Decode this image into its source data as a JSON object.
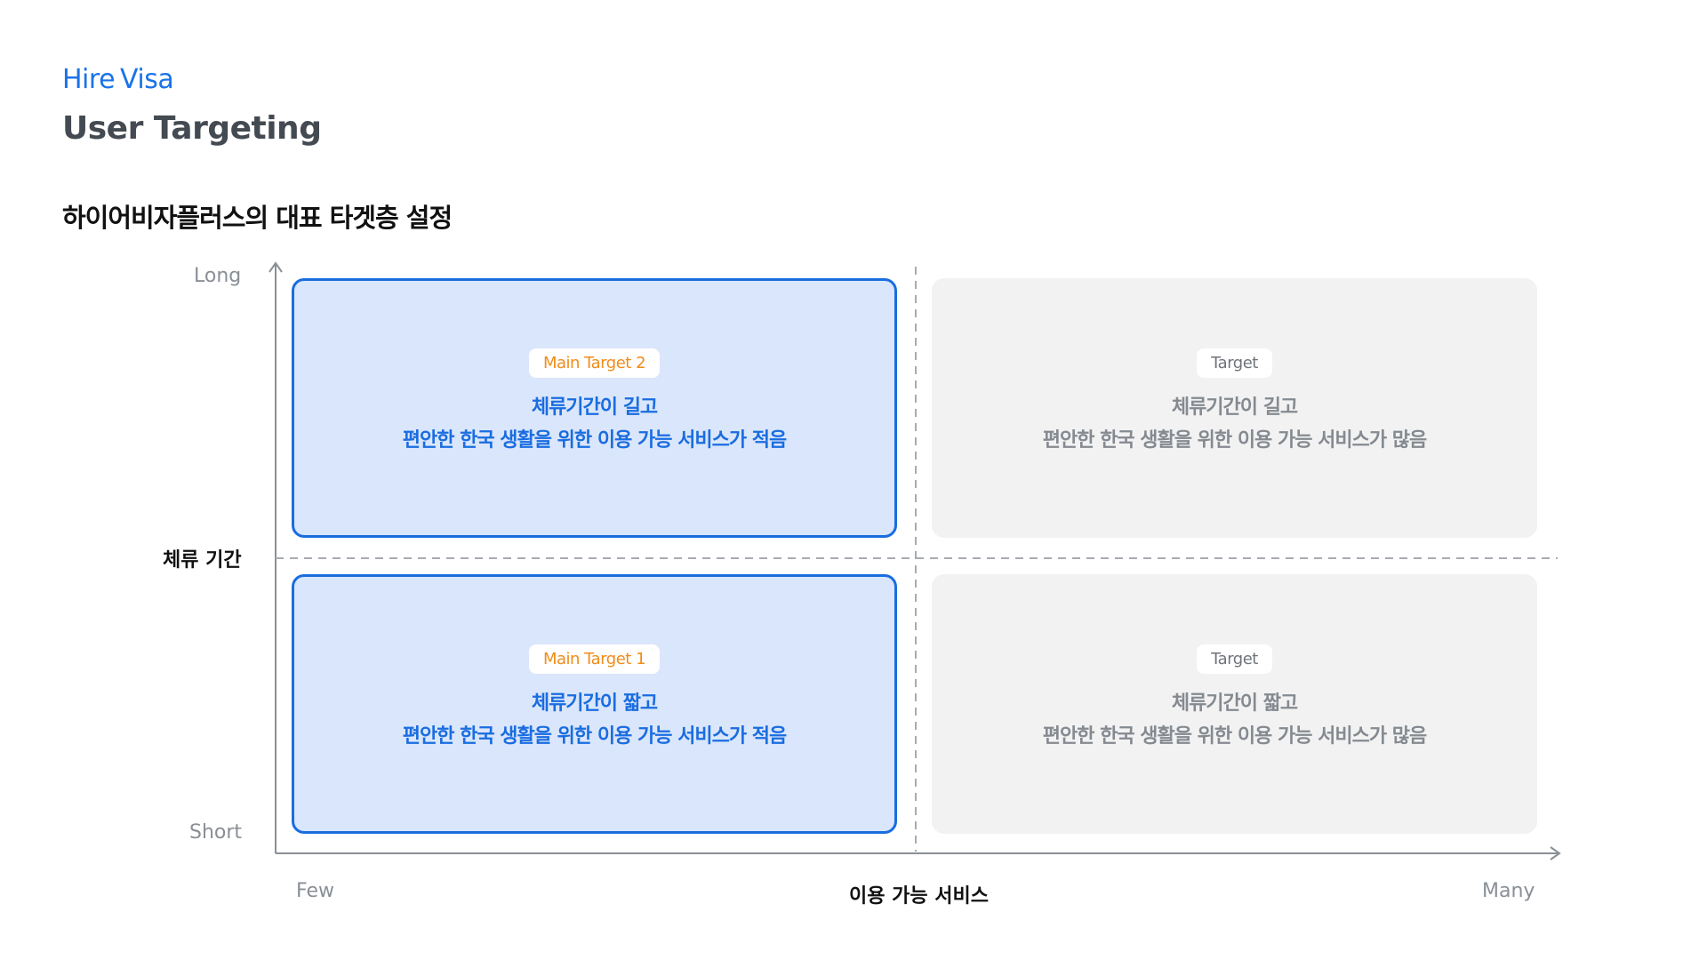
{
  "header": {
    "logo_part1": "Hire",
    "logo_part2": "Visa",
    "title": "User Targeting",
    "subtitle": "하이어비자플러스의 대표 타겟층 설정"
  },
  "axes": {
    "y_title": "체류 기간",
    "y_high": "Long",
    "y_low": "Short",
    "x_title": "이용 가능 서비스",
    "x_low": "Few",
    "x_high": "Many"
  },
  "quadrants": {
    "top_left": {
      "badge": "Main Target 2",
      "line1": "체류기간이 길고",
      "line2": "편안한 한국 생활을 위한 이용 가능 서비스가 적음"
    },
    "top_right": {
      "badge": "Target",
      "line1": "체류기간이 길고",
      "line2": "편안한 한국 생활을 위한 이용 가능 서비스가 많음"
    },
    "bottom_left": {
      "badge": "Main Target 1",
      "line1": "체류기간이 짧고",
      "line2": "편안한 한국 생활을 위한 이용 가능 서비스가 적음"
    },
    "bottom_right": {
      "badge": "Target",
      "line1": "체류기간이 짧고",
      "line2": "편안한 한국 생활을 위한 이용 가능 서비스가 많음"
    }
  },
  "colors": {
    "brand_blue": "#1a6de0",
    "main_fill": "#dae6fb",
    "badge_orange": "#f08c1a",
    "other_fill": "#f2f2f2"
  }
}
